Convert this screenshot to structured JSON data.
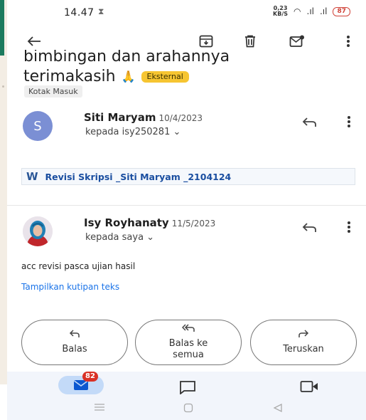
{
  "status": {
    "time": "14.47",
    "speed_value": "0,23",
    "speed_unit": "KB/S",
    "wifi": "◠",
    "signal1": ".ıl",
    "signal2": ".ıl",
    "battery": "87"
  },
  "toolbar": {
    "back": "←",
    "archive": "⧈",
    "delete": "Ὕ1",
    "mark_unread": "✉",
    "more": "⋮"
  },
  "email": {
    "subject_line1": "bimbingan dan arahannya",
    "subject_line2": "terimakasih",
    "emoji": "🙏",
    "external_badge": "Eksternal",
    "label": "Kotak Masuk"
  },
  "messages": [
    {
      "avatar_letter": "S",
      "sender": "Siti Maryam",
      "date": "10/4/2023",
      "to": "kepada isy250281",
      "chevron": "⌄"
    },
    {
      "sender": "Isy Royhanaty",
      "date": "11/5/2023",
      "to": "kepada saya",
      "chevron": "⌄",
      "body": "acc revisi pasca ujian hasil",
      "quote_link": "Tampilkan kutipan teks"
    }
  ],
  "attachment": {
    "icon": "W",
    "name": "Revisi Skripsi _Siti Maryam _2104124"
  },
  "actions": [
    {
      "icon": "↰",
      "label": "Balas"
    },
    {
      "icon": "≪",
      "label": "Balas ke semua"
    },
    {
      "icon": "↱",
      "label": "Teruskan"
    }
  ],
  "bottom_nav": {
    "mail_badge": "82"
  },
  "colors": {
    "accent_link": "#1a73e8",
    "avatar_s": "#7b8fd4",
    "badge_red": "#d93025",
    "external_badge": "#f6c531",
    "nav_pill": "#c3daf8"
  }
}
